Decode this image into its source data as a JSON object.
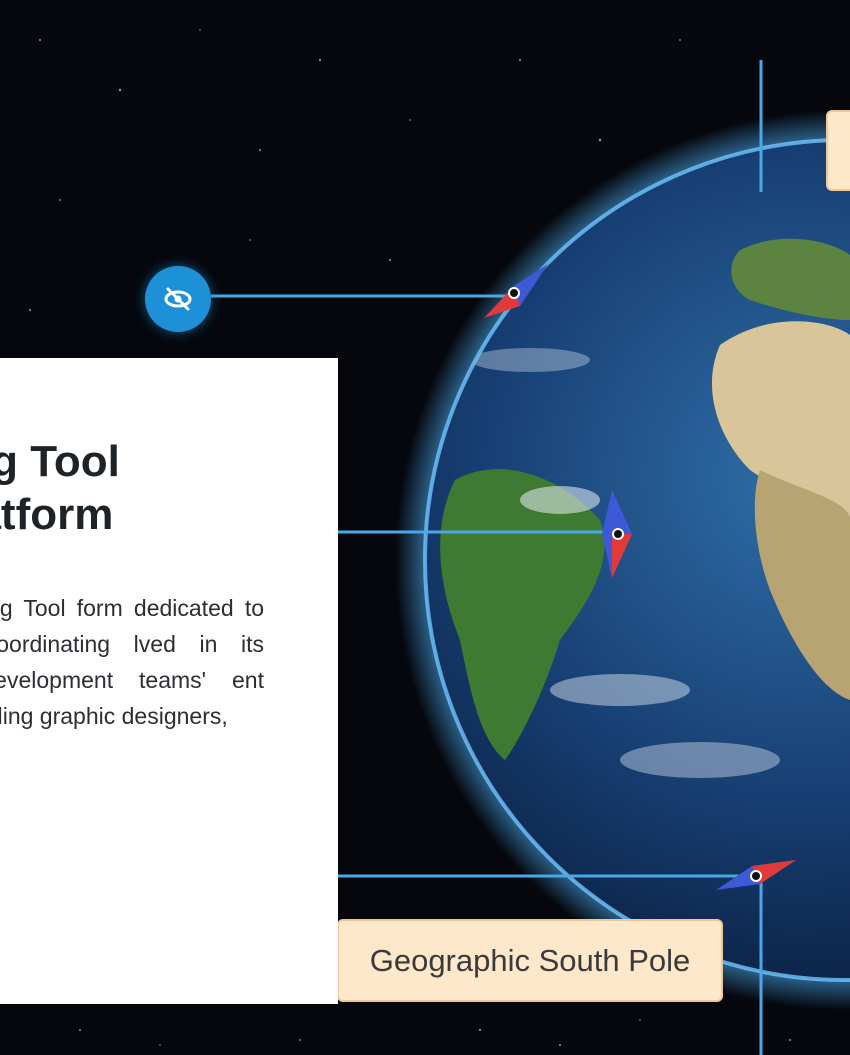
{
  "panel": {
    "heading_line1": "oring Tool",
    "heading_line2": "t Platform",
    "paragraph": "ful Authoring Tool form dedicated to nt and coordinating lved in its creation. evelopment teams' ent roles, including graphic designers,"
  },
  "labels": {
    "south_pole": "Geographic South Pole"
  },
  "icons": {
    "visibility_toggle": "eye-off-icon"
  },
  "colors": {
    "space": "#05070c",
    "accent": "#1e90d8",
    "callout_line": "#4aa8e6",
    "tag_fill": "#fde8cc",
    "marker_red": "#e03a3a",
    "marker_blue": "#3c5ad8"
  }
}
